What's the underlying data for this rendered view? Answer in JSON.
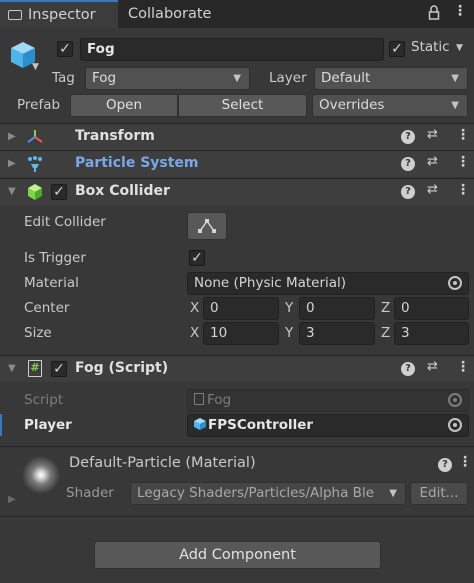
{
  "tabs": [
    {
      "label": "Inspector"
    },
    {
      "label": "Collaborate"
    }
  ],
  "header": {
    "name": "Fog",
    "static_label": "Static",
    "tag_label": "Tag",
    "tag_value": "Fog",
    "layer_label": "Layer",
    "layer_value": "Default",
    "prefab_label": "Prefab",
    "open_label": "Open",
    "select_label": "Select",
    "overrides_label": "Overrides"
  },
  "components": {
    "transform": {
      "title": "Transform"
    },
    "particle_system": {
      "title": "Particle System",
      "title_color": "#7aa7e8"
    },
    "box_collider": {
      "title": "Box Collider",
      "edit_collider_label": "Edit Collider",
      "is_trigger_label": "Is Trigger",
      "material_label": "Material",
      "material_value": "None (Physic Material)",
      "center_label": "Center",
      "center": {
        "x": "0",
        "y": "0",
        "z": "0"
      },
      "size_label": "Size",
      "size": {
        "x": "10",
        "y": "3",
        "z": "3"
      },
      "axis_x": "X",
      "axis_y": "Y",
      "axis_z": "Z"
    },
    "fog_script": {
      "title": "Fog (Script)",
      "script_label": "Script",
      "script_value": "Fog",
      "player_label": "Player",
      "player_value": "FPSController"
    }
  },
  "material": {
    "title": "Default-Particle (Material)",
    "shader_label": "Shader",
    "shader_value": "Legacy Shaders/Particles/Alpha Ble",
    "edit_label": "Edit..."
  },
  "footer": {
    "add_component_label": "Add Component"
  },
  "colors": {
    "accent_tab": "#3a79bb",
    "panel_bg": "#383838",
    "link": "#7aa7e8"
  }
}
